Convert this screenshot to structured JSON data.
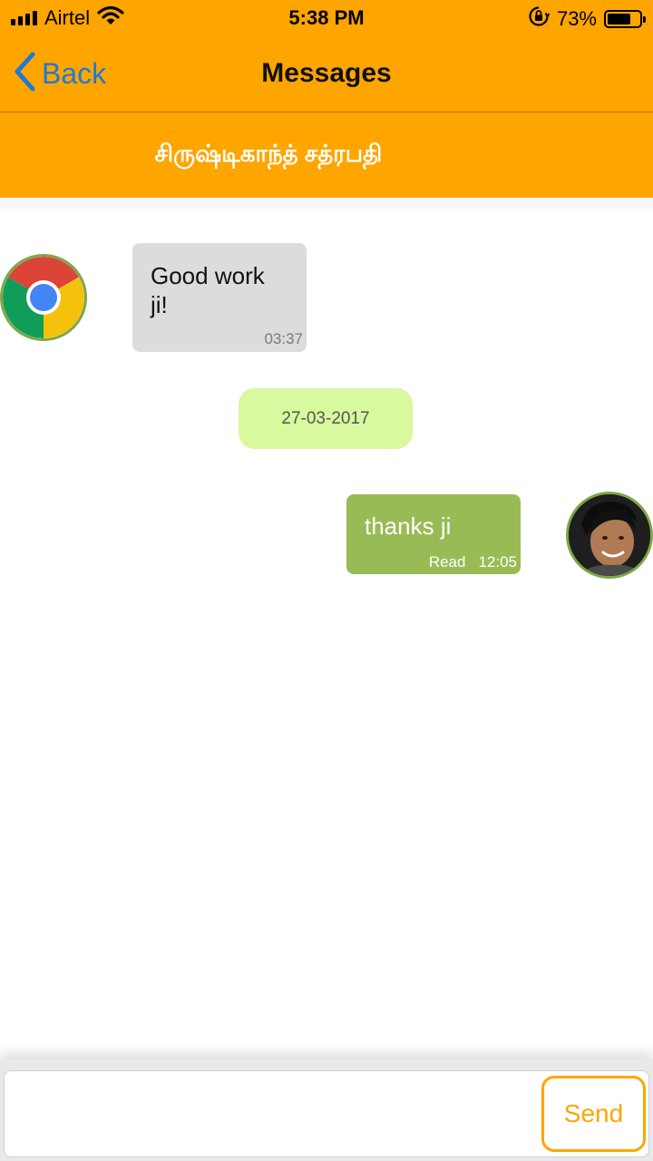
{
  "status_bar": {
    "carrier": "Airtel",
    "time": "5:38 PM",
    "battery_text": "73%",
    "battery_level": 0.73,
    "icons": [
      "signal-icon",
      "wifi-icon",
      "orientation-lock-icon",
      "battery-icon"
    ]
  },
  "nav": {
    "back_label": "Back",
    "title": "Messages"
  },
  "contact": {
    "name": "சிருஷ்டிகாந்த் சத்ரபதி"
  },
  "messages": [
    {
      "direction": "incoming",
      "text": "Good work ji!",
      "time": "03:37",
      "avatar": "chrome-icon"
    },
    {
      "direction": "outgoing",
      "text": "thanks ji",
      "status": "Read",
      "time": "12:05",
      "avatar": "user-photo"
    }
  ],
  "date_separator": "27-03-2017",
  "composer": {
    "value": "",
    "send_label": "Send"
  },
  "colors": {
    "header": "#FFA500",
    "incoming_bubble": "#DCDCDC",
    "outgoing_bubble": "#99BB55",
    "date_chip": "#D8F99D",
    "back_link": "#1E7AD6",
    "send_accent": "#FFA500"
  }
}
